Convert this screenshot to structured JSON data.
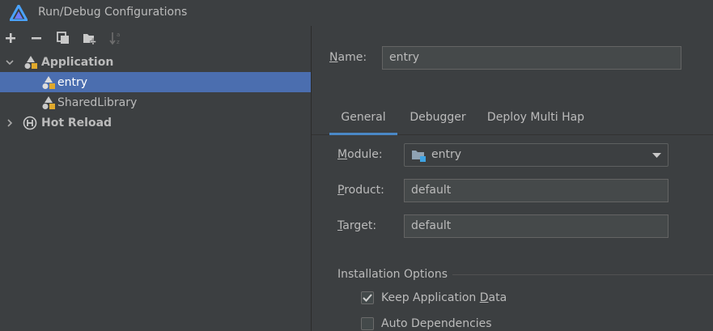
{
  "window": {
    "title": "Run/Debug Configurations",
    "logo_icon": "deveco-logo-icon"
  },
  "toolbar": {
    "buttons": [
      {
        "name": "add-icon"
      },
      {
        "name": "remove-icon"
      },
      {
        "name": "copy-icon"
      },
      {
        "name": "new-folder-icon"
      },
      {
        "name": "sort-alphabetically-icon"
      }
    ]
  },
  "tree": {
    "items": [
      {
        "label": "Application",
        "level": 0,
        "expanded": true,
        "bold": true,
        "icon": "application-icon"
      },
      {
        "label": "entry",
        "level": 1,
        "selected": true,
        "icon": "config-icon"
      },
      {
        "label": "SharedLibrary",
        "level": 1,
        "icon": "config-icon"
      },
      {
        "label": "Hot Reload",
        "level": 0,
        "expanded": false,
        "bold": true,
        "icon": "hot-reload-icon"
      }
    ]
  },
  "form": {
    "name_label_first": "N",
    "name_label_rest": "ame:",
    "name_value": "entry",
    "tabs": [
      "General",
      "Debugger",
      "Deploy Multi Hap"
    ],
    "active_tab": "General",
    "module_label_first": "M",
    "module_label_rest": "odule:",
    "module_value": "entry",
    "product_label_first": "P",
    "product_label_rest": "roduct:",
    "product_value": "default",
    "target_label_first": "T",
    "target_label_rest": "arget:",
    "target_value": "default",
    "installation_options_title": "Installation Options",
    "keep_data_prefix": "Keep Application ",
    "keep_data_mnemonic": "D",
    "keep_data_suffix": "ata",
    "keep_data_checked": true,
    "auto_dependencies": "Auto Dependencies",
    "auto_dependencies_checked": false
  },
  "colors": {
    "background": "#3c3f41",
    "selection": "#4b6eaf",
    "tab_underline": "#4a88c7",
    "text": "#bbbbbb"
  }
}
